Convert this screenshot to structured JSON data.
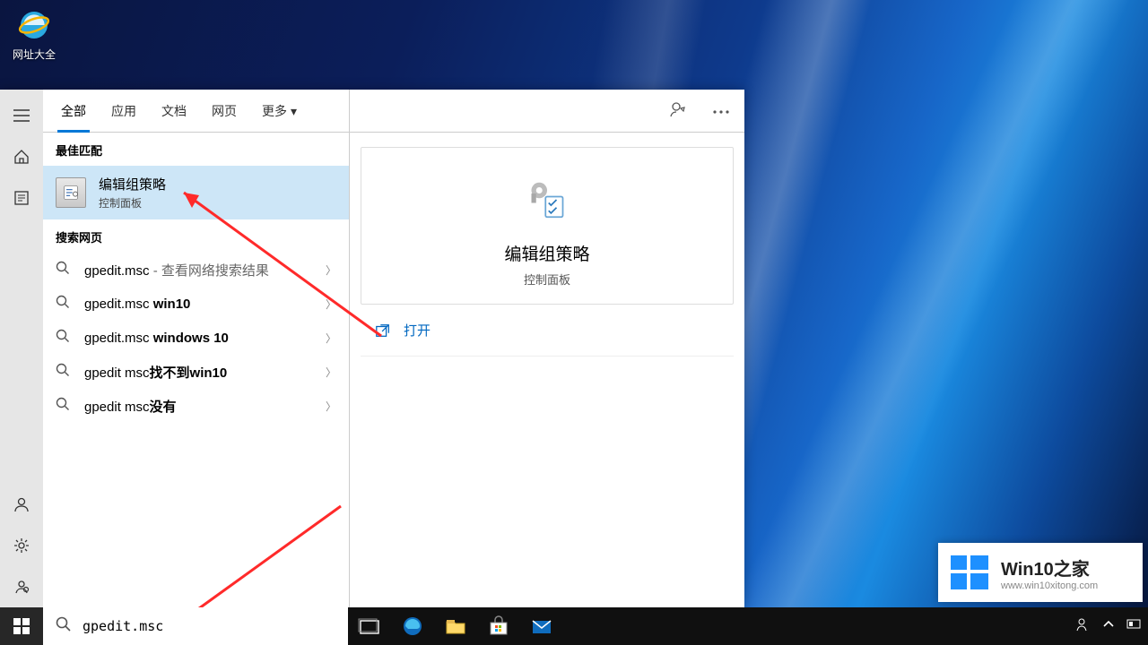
{
  "desktop_icon_label": "网址大全",
  "search_input_value": "gpedit.msc",
  "tabs": [
    "全部",
    "应用",
    "文档",
    "网页",
    "更多"
  ],
  "active_tab_index": 0,
  "section_best_match": "最佳匹配",
  "best_match": {
    "title": "编辑组策略",
    "subtitle": "控制面板"
  },
  "section_web": "搜索网页",
  "web_results": [
    {
      "query": "gpedit.msc",
      "bold": "",
      "suffix": " - 查看网络搜索结果"
    },
    {
      "query": "gpedit.msc ",
      "bold": "win10",
      "suffix": ""
    },
    {
      "query": "gpedit.msc ",
      "bold": "windows 10",
      "suffix": ""
    },
    {
      "query": "gpedit msc",
      "bold": "找不到win10",
      "suffix": ""
    },
    {
      "query": "gpedit msc",
      "bold": "没有",
      "suffix": ""
    }
  ],
  "right_panel": {
    "title": "编辑组策略",
    "subtitle": "控制面板",
    "open_label": "打开"
  },
  "watermark": {
    "line1": "Win10之家",
    "line2": "www.win10xitong.com"
  }
}
